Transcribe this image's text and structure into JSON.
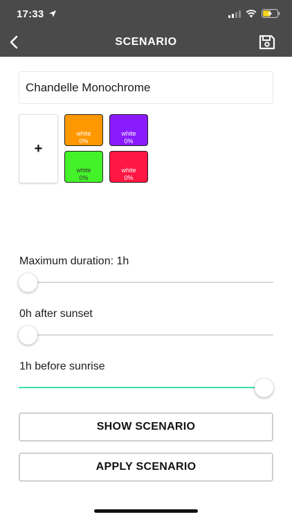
{
  "status": {
    "time": "17:33"
  },
  "nav": {
    "title": "SCENARIO"
  },
  "scenario": {
    "name": "Chandelle Monochrome"
  },
  "add_tile": {
    "label": "+"
  },
  "colors": [
    {
      "name": "white",
      "percent": "0%",
      "color": "#ff9800"
    },
    {
      "name": "white",
      "percent": "0%",
      "color": "#8b1bff"
    },
    {
      "name": "white",
      "percent": "0%",
      "color": "#44f22a"
    },
    {
      "name": "white",
      "percent": "0%",
      "color": "#ff1744"
    }
  ],
  "sliders": [
    {
      "label": "Maximum duration: 1h",
      "value": 0.0
    },
    {
      "label": "0h after sunset",
      "value": 0.0
    },
    {
      "label": "1h before sunrise",
      "value": 1.0
    }
  ],
  "buttons": {
    "show": "SHOW SCENARIO",
    "apply": "APPLY SCENARIO"
  },
  "theme": {
    "bar": "#4a4a4a",
    "accent": "#39e0b0"
  }
}
